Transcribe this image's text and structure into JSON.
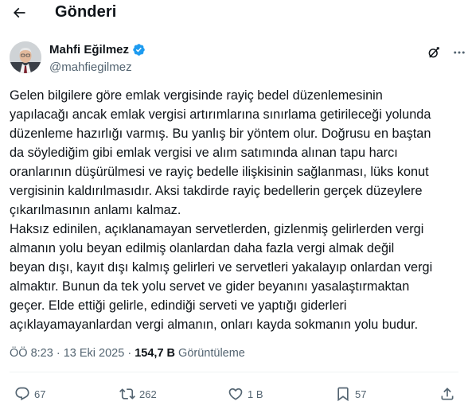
{
  "header": {
    "title": "Gönderi"
  },
  "author": {
    "display_name": "Mahfi Eğilmez",
    "handle": "@mahfiegilmez"
  },
  "tweet": {
    "lines": [
      "Gelen bilgilere göre emlak vergisinde rayiç bedel düzenlemesinin",
      "yapılacağı ancak emlak vergisi artırımlarına sınırlama getirileceği yolunda",
      "düzenleme hazırlığı varmış. Bu yanlış bir yöntem olur. Doğrusu en baştan",
      "da söylediğim gibi emlak vergisi ve alım satımında alınan tapu harcı",
      "oranlarının düşürülmesi ve rayiç bedelle ilişkisinin sağlanması, lüks konut",
      "vergisinin kaldırılmasıdır. Aksi takdirde rayiç bedellerin gerçek düzeylere",
      "çıkarılmasının anlamı kalmaz.",
      "Haksız edinilen, açıklanamayan servetlerden, gizlenmiş gelirlerden vergi",
      "almanın yolu beyan edilmiş olanlardan daha fazla vergi almak değil",
      "beyan dışı, kayıt dışı kalmış gelirleri ve servetleri yakalayıp onlardan vergi",
      "almaktır. Bunun da tek yolu servet ve gider beyanını yasalaştırmaktan",
      "geçer. Elde ettiği gelirle, edindiği serveti ve yaptığı giderleri",
      "açıklayamayanlardan vergi almanın, onları kayda sokmanın yolu budur."
    ]
  },
  "meta": {
    "time": "ÖÖ 8:23",
    "separator": "·",
    "date": "13 Eki 2025",
    "views_count": "154,7 B",
    "views_label": "Görüntüleme"
  },
  "actions": {
    "replies": "67",
    "reposts": "262",
    "likes": "1 B",
    "bookmarks": "57"
  },
  "icons": {
    "back": "arrow-left-icon",
    "verified": "verified-badge-icon",
    "grok": "grok-icon",
    "more": "more-dots-icon",
    "reply": "reply-icon",
    "repost": "repost-icon",
    "like": "heart-icon",
    "bookmark": "bookmark-icon",
    "share": "share-icon"
  },
  "colors": {
    "text": "#0f1419",
    "secondary": "#536471",
    "verified": "#1d9bf0"
  }
}
